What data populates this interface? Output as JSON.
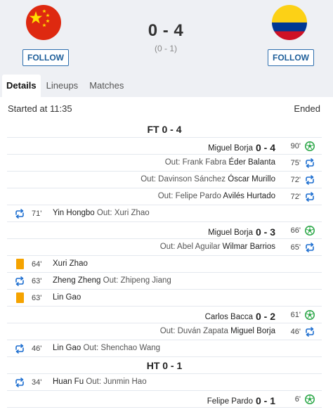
{
  "match": {
    "score": "0 - 4",
    "halftime_score": "(0 - 1)"
  },
  "home": {
    "flag": "china-flag",
    "follow_label": "FOLLOW"
  },
  "away": {
    "flag": "colombia-flag",
    "follow_label": "FOLLOW"
  },
  "tabs": [
    {
      "label": "Details",
      "active": true
    },
    {
      "label": "Lineups",
      "active": false
    },
    {
      "label": "Matches",
      "active": false
    }
  ],
  "status": {
    "started": "Started at 11:35",
    "ended": "Ended"
  },
  "colors": {
    "sub_icon": "#1e6fd0",
    "goal_icon": "#2ea84a",
    "yellow_card": "#f5a300",
    "follow_border": "#2e6fae"
  },
  "events": [
    {
      "kind": "section",
      "label": "FT 0 - 4"
    },
    {
      "kind": "goal",
      "side": "right",
      "minute": "90'",
      "player": "Miguel Borja",
      "score": "0 - 4"
    },
    {
      "kind": "sub",
      "side": "right",
      "minute": "75'",
      "out_label": "Out: Frank Fabra",
      "player": "Éder Balanta"
    },
    {
      "kind": "sub",
      "side": "right",
      "minute": "72'",
      "out_label": "Out: Davinson Sánchez",
      "player": "Óscar Murillo"
    },
    {
      "kind": "sub",
      "side": "right",
      "minute": "72'",
      "out_label": "Out: Felipe Pardo",
      "player": "Avilés Hurtado"
    },
    {
      "kind": "sub",
      "side": "left",
      "minute": "71'",
      "player": "Yin Hongbo",
      "out_label": "Out: Xuri Zhao"
    },
    {
      "kind": "goal",
      "side": "right",
      "minute": "66'",
      "player": "Miguel Borja",
      "score": "0 - 3"
    },
    {
      "kind": "sub",
      "side": "right",
      "minute": "65'",
      "out_label": "Out: Abel Aguilar",
      "player": "Wilmar Barrios"
    },
    {
      "kind": "card",
      "side": "left",
      "minute": "64'",
      "player": "Xuri Zhao"
    },
    {
      "kind": "sub",
      "side": "left",
      "minute": "63'",
      "player": "Zheng Zheng",
      "out_label": "Out: Zhipeng Jiang"
    },
    {
      "kind": "card",
      "side": "left",
      "minute": "63'",
      "player": "Lin Gao"
    },
    {
      "kind": "goal",
      "side": "right",
      "minute": "61'",
      "player": "Carlos Bacca",
      "score": "0 - 2"
    },
    {
      "kind": "sub",
      "side": "right",
      "minute": "46'",
      "out_label": "Out: Duván Zapata",
      "player": "Miguel Borja"
    },
    {
      "kind": "sub",
      "side": "left",
      "minute": "46'",
      "player": "Lin Gao",
      "out_label": "Out: Shenchao Wang"
    },
    {
      "kind": "section",
      "label": "HT 0 - 1"
    },
    {
      "kind": "sub",
      "side": "left",
      "minute": "34'",
      "player": "Huan Fu",
      "out_label": "Out: Junmin Hao"
    },
    {
      "kind": "goal",
      "side": "right",
      "minute": "6'",
      "player": "Felipe Pardo",
      "score": "0 - 1"
    }
  ]
}
